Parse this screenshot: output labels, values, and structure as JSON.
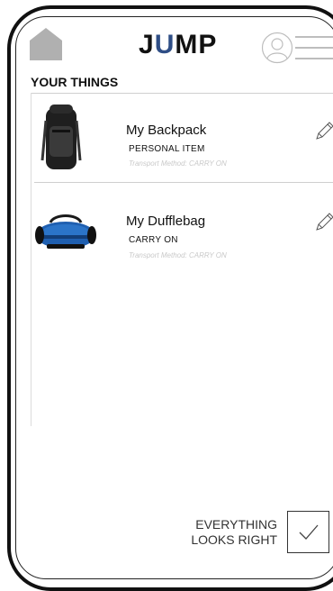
{
  "app": {
    "logo_prefix": "J",
    "logo_accent": "U",
    "logo_suffix": "MP",
    "accent_color": "#2f4e86"
  },
  "header": {
    "home_icon": "home-icon",
    "avatar_icon": "user-avatar-icon",
    "menu_icon": "hamburger-menu-icon"
  },
  "section": {
    "title": "YOUR THINGS"
  },
  "items": [
    {
      "title": "My Backpack",
      "category": "PERSONAL ITEM",
      "transport": "Transport Method: CARRY ON",
      "edit_icon": "pencil-icon",
      "image": "backpack"
    },
    {
      "title": "My Dufflebag",
      "category": "CARRY ON",
      "transport": "Transport Method: CARRY ON",
      "edit_icon": "pencil-icon",
      "image": "duffel-bag"
    }
  ],
  "footer": {
    "confirm_line1": "EVERYTHING",
    "confirm_line2": "LOOKS RIGHT",
    "confirm_icon": "checkmark-icon"
  }
}
